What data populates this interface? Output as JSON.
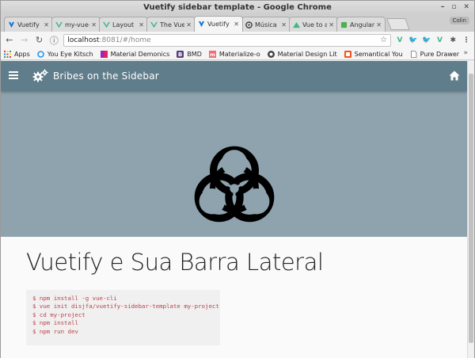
{
  "window": {
    "title": "Vuetify sidebar template - Google Chrome",
    "controls": [
      "–",
      "▫",
      "✕"
    ]
  },
  "tabs": [
    {
      "label": "Vuetify",
      "favicon_color": "#1976d2",
      "active": false
    },
    {
      "label": "my-vue-",
      "favicon_color": "#41b883",
      "active": false
    },
    {
      "label": "Layout",
      "favicon_color": "#41b883",
      "active": false
    },
    {
      "label": "The Vue",
      "favicon_color": "#41b883",
      "active": false
    },
    {
      "label": "Vuetify",
      "favicon_color": "#1976d2",
      "active": true
    },
    {
      "label": "Música",
      "favicon_color": "#333333",
      "active": false
    },
    {
      "label": "Vue to a",
      "favicon_color": "#41b883",
      "active": false
    },
    {
      "label": "Angular",
      "favicon_color": "#4caf50",
      "active": false
    }
  ],
  "profile_label": "Colin",
  "omnibox": {
    "host": "localhost",
    "path": ":8081/#/home"
  },
  "bookmarks": [
    {
      "label": "Apps",
      "icon": "apps-grid-icon",
      "color": "#5f6368"
    },
    {
      "label": "You Eye Kitsch",
      "icon": "bookmark-favicon",
      "color": "#2196f3"
    },
    {
      "label": "Material Demonics",
      "icon": "bookmark-favicon",
      "color": "#9c27b0"
    },
    {
      "label": "BMD",
      "icon": "bookmark-favicon",
      "color": "#563d7c"
    },
    {
      "label": "Materialize-o",
      "icon": "bookmark-favicon",
      "color": "#ee6e73"
    },
    {
      "label": "Material Design Lit",
      "icon": "bookmark-favicon",
      "color": "#424242"
    },
    {
      "label": "Semantical You",
      "icon": "bookmark-favicon",
      "color": "#f4511e"
    },
    {
      "label": "Pure Drawer",
      "icon": "page-icon",
      "color": "#9e9e9e"
    }
  ],
  "bookmarks_more": "»",
  "app": {
    "title": "Bribes on the Sidebar",
    "bar_color": "#607d8b",
    "hero_color": "#8fa3ae"
  },
  "page": {
    "heading": "Vuetify e Sua Barra Lateral",
    "code_lines": [
      "$ npm install -g vue-cli",
      "$ vue init disjfa/vuetify-sidebar-template my-project",
      "$ cd my-project",
      "$ npm install",
      "$ npm run dev"
    ]
  }
}
